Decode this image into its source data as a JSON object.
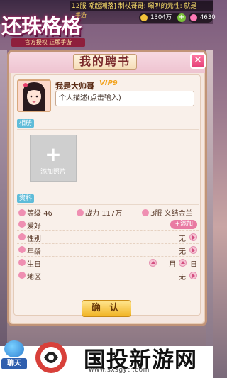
{
  "top": {
    "marquee": "12服 潮起潮落] 制杖哥哥: 唰叭的元性: 就是",
    "gold": "1304万",
    "gems": "4630"
  },
  "logo": {
    "title": "还珠格格",
    "tag": "手游",
    "subtitle": "官方授权 正版手游"
  },
  "panel": {
    "title": "我的聘书",
    "close": "✕",
    "nickname": "我是大帅哥",
    "vip": "VIP9",
    "desc_placeholder": "个人描述(点击输入)",
    "album_tag": "相册",
    "add_photo_plus": "+",
    "add_photo_label": "添加照片",
    "info_tag": "资料",
    "level_label": "等级",
    "level_value": "46",
    "power_label": "战力",
    "power_value": "117万",
    "server": "3服 义结金兰",
    "hobby_label": "爱好",
    "add_label": "+添加",
    "gender_label": "性别",
    "gender_value": "无",
    "age_label": "年龄",
    "age_value": "无",
    "birthday_label": "生日",
    "month_label": "月",
    "day_label": "日",
    "region_label": "地区",
    "region_value": "无",
    "confirm": "确 认"
  },
  "bottom": {
    "chat": "聊天",
    "watermark": "国投新游网",
    "url": "www.sxsgytr.com"
  }
}
